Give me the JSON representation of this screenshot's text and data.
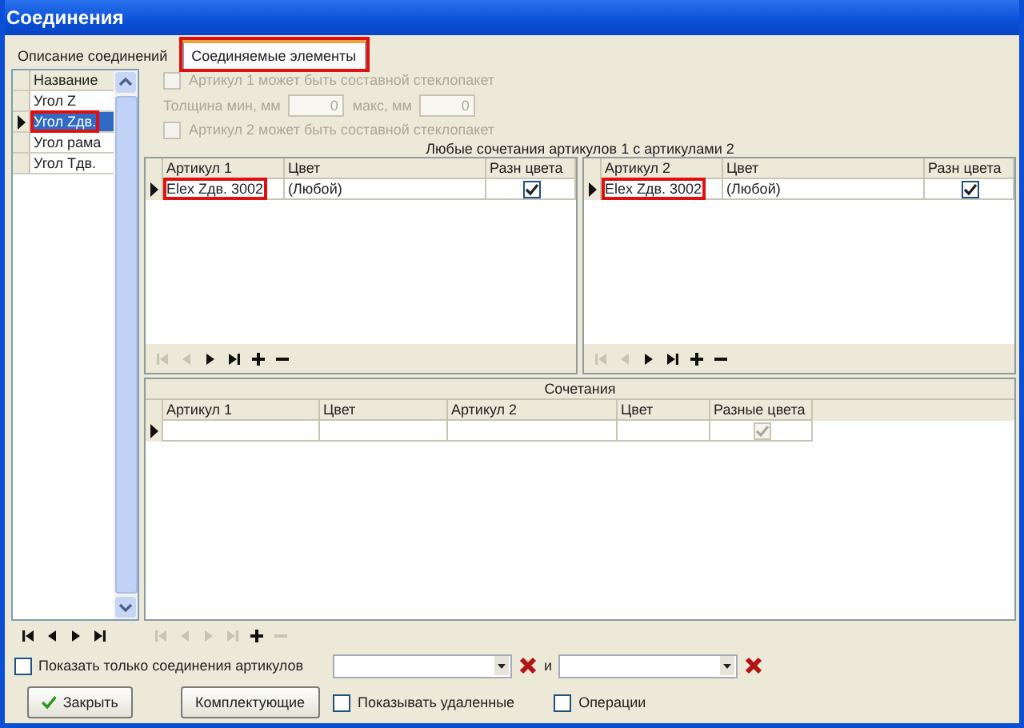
{
  "window": {
    "title": "Соединения"
  },
  "tabs": [
    {
      "label": "Описание соединений",
      "selected": false,
      "highlighted": false
    },
    {
      "label": "Соединяемые элементы",
      "selected": true,
      "highlighted": true
    }
  ],
  "joints_list": {
    "column": "Название",
    "rows": [
      {
        "name": "Угол Z",
        "selected": false,
        "highlighted": false
      },
      {
        "name": "Угол Zдв.",
        "selected": true,
        "highlighted": true
      },
      {
        "name": "Угол рама",
        "selected": false,
        "highlighted": false
      },
      {
        "name": "Угол Tдв.",
        "selected": false,
        "highlighted": false
      }
    ],
    "navigator": [
      {
        "kind": "first",
        "disabled": false
      },
      {
        "kind": "prev",
        "disabled": false
      },
      {
        "kind": "next",
        "disabled": false
      },
      {
        "kind": "last",
        "disabled": false
      }
    ]
  },
  "options": [
    {
      "kind": "checkbox",
      "label": "Артикул 1 может быть составной стеклопакет",
      "checked": false,
      "disabled": true
    },
    {
      "kind": "thickness",
      "label_min": "Толщина мин, мм",
      "min": "0",
      "label_max": "макс, мм",
      "max": "0",
      "disabled": true
    },
    {
      "kind": "checkbox",
      "label": "Артикул 2 может быть составной стеклопакет",
      "checked": false,
      "disabled": true
    }
  ],
  "combinations_caption": "Любые сочетания артикулов 1 с артикулами 2",
  "grids": [
    {
      "columns": [
        "Артикул 1",
        "Цвет",
        "Разн цвета"
      ],
      "rows": [
        {
          "article": "Elex Zдв. 3002",
          "color_name": "(Любой)",
          "different_colors": true,
          "current": true,
          "highlighted": true
        }
      ],
      "navigator": [
        {
          "kind": "first",
          "disabled": true
        },
        {
          "kind": "prev",
          "disabled": true
        },
        {
          "kind": "next",
          "disabled": false
        },
        {
          "kind": "last",
          "disabled": false
        },
        {
          "kind": "add",
          "disabled": false
        },
        {
          "kind": "delete",
          "disabled": false
        }
      ]
    },
    {
      "columns": [
        "Артикул 2",
        "Цвет",
        "Разн цвета"
      ],
      "rows": [
        {
          "article": "Elex Zдв. 3002",
          "color_name": "(Любой)",
          "different_colors": true,
          "current": true,
          "highlighted": true
        }
      ],
      "navigator": [
        {
          "kind": "first",
          "disabled": true
        },
        {
          "kind": "prev",
          "disabled": true
        },
        {
          "kind": "next",
          "disabled": false
        },
        {
          "kind": "last",
          "disabled": false
        },
        {
          "kind": "add",
          "disabled": false
        },
        {
          "kind": "delete",
          "disabled": false
        }
      ]
    }
  ],
  "pairs": {
    "title": "Сочетания",
    "columns": [
      "Артикул 1",
      "Цвет",
      "Артикул 2",
      "Цвет",
      "Разные цвета"
    ],
    "rows": [
      {
        "current": true,
        "different_colors": true
      }
    ],
    "navigator": [
      {
        "kind": "first",
        "disabled": true
      },
      {
        "kind": "prev",
        "disabled": true
      },
      {
        "kind": "next",
        "disabled": true
      },
      {
        "kind": "last",
        "disabled": true
      },
      {
        "kind": "add",
        "disabled": false
      },
      {
        "kind": "delete",
        "disabled": true
      }
    ]
  },
  "filter": {
    "label": "Показать только соединения артикулов",
    "checked": false,
    "conjunction": "и"
  },
  "buttons": [
    {
      "kind": "close",
      "label": "Закрыть"
    },
    {
      "kind": "plain",
      "label": "Комплектующие"
    }
  ],
  "checkboxes": [
    {
      "label": "Показывать удаленные",
      "checked": false
    },
    {
      "label": "Операции",
      "checked": false
    }
  ]
}
